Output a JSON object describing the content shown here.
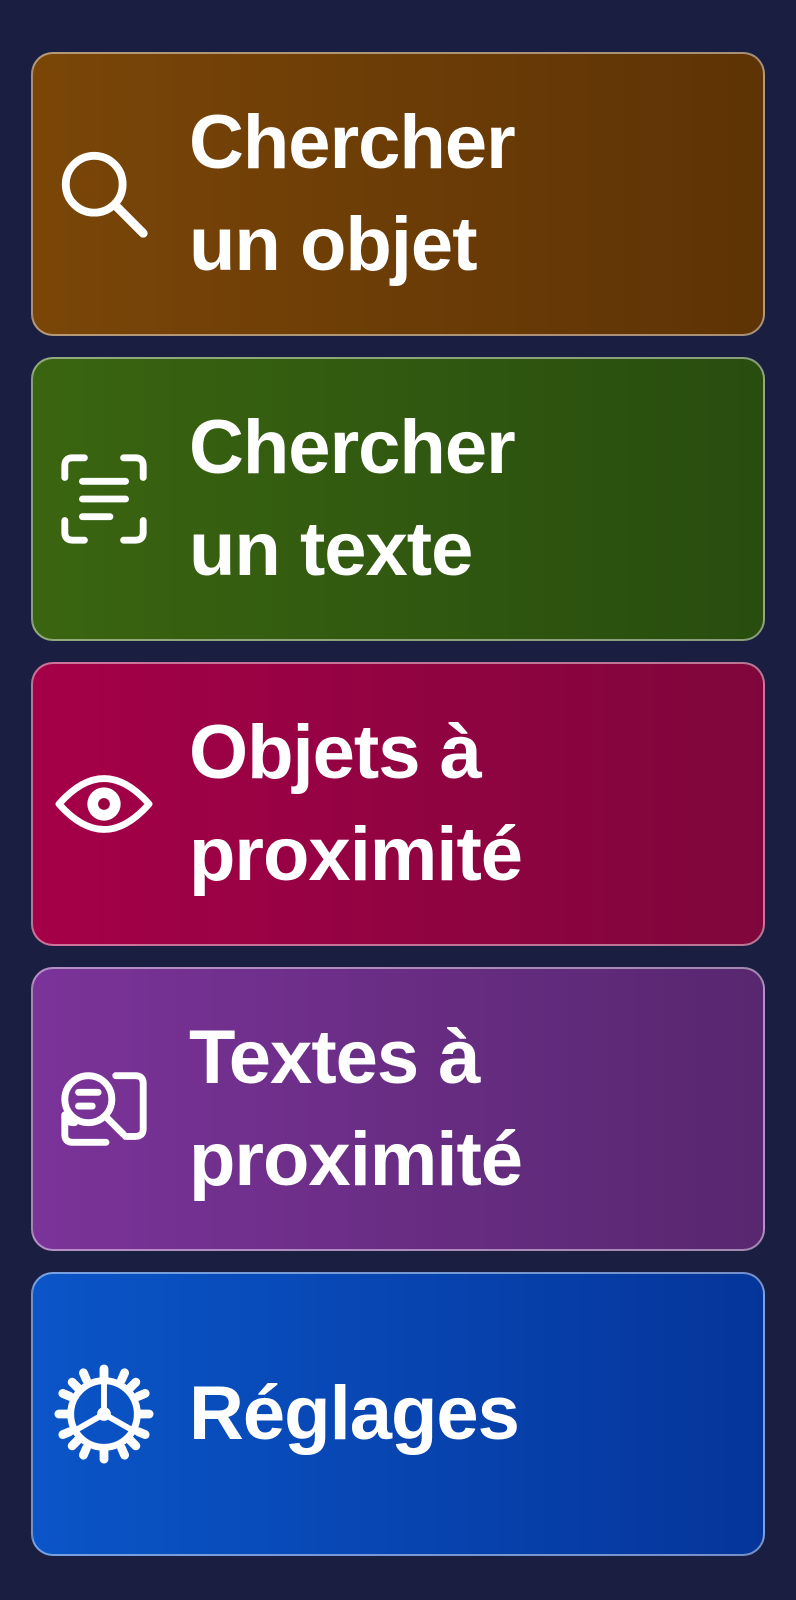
{
  "menu": {
    "items": [
      {
        "id": "search-object",
        "icon": "search-icon",
        "lines": [
          "Chercher",
          "un objet"
        ],
        "color_start": "#7a4608",
        "color_end": "#5e3305"
      },
      {
        "id": "search-text",
        "icon": "text-scan-icon",
        "lines": [
          "Chercher",
          "un texte"
        ],
        "color_start": "#3a6510",
        "color_end": "#284d0f"
      },
      {
        "id": "nearby-objects",
        "icon": "eye-icon",
        "lines": [
          "Objets à",
          "proximité"
        ],
        "color_start": "#a50048",
        "color_end": "#7f063b"
      },
      {
        "id": "nearby-texts",
        "icon": "text-search-icon",
        "lines": [
          "Textes à",
          "proximité"
        ],
        "color_start": "#7b3399",
        "color_end": "#57276f"
      },
      {
        "id": "settings",
        "icon": "gear-icon",
        "lines": [
          "Réglages"
        ],
        "color_start": "#0a55c8",
        "color_end": "#05359a"
      }
    ]
  },
  "colors": {
    "background": "#1a1f42",
    "text": "#ffffff"
  }
}
